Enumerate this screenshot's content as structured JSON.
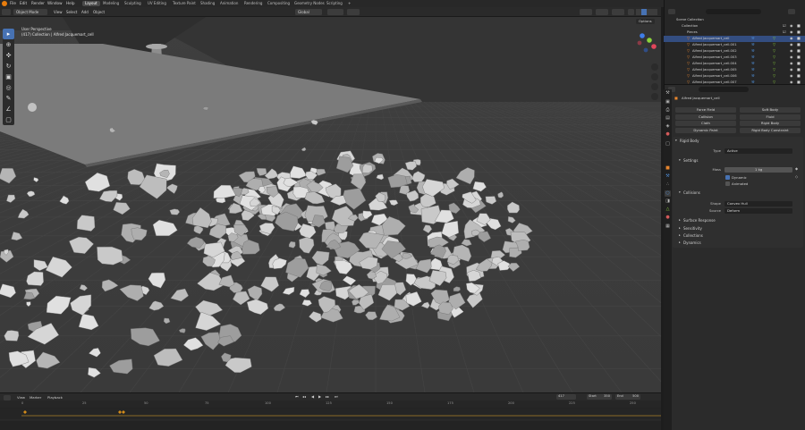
{
  "topbar": {
    "menus": [
      "File",
      "Edit",
      "Render",
      "Window",
      "Help"
    ],
    "workspaces": [
      "Layout",
      "Modeling",
      "Sculpting",
      "UV Editing",
      "Texture Paint",
      "Shading",
      "Animation",
      "Rendering",
      "Compositing",
      "Geometry Nodes",
      "Scripting"
    ],
    "active_workspace": "Layout",
    "scene": "Scene",
    "view_layer": "ViewLayer"
  },
  "viewport_header": {
    "mode": "Object Mode",
    "menus": [
      "View",
      "Select",
      "Add",
      "Object"
    ],
    "transform": "Global",
    "options": "Options"
  },
  "viewport": {
    "perspective": "User Perspective",
    "collection_info": "(417) Collection | Alfred Jacquemart_cell",
    "tools": [
      "cursor-select",
      "cursor",
      "move",
      "rotate",
      "scale",
      "transform",
      "annotate",
      "measure",
      "add-cube"
    ]
  },
  "timeline": {
    "menus": [
      "View",
      "Marker",
      "Playback"
    ],
    "current_frame": "417",
    "start_label": "Start",
    "start": "350",
    "end_label": "End",
    "end": "500",
    "ticks": [
      "0",
      "25",
      "50",
      "75",
      "100",
      "125",
      "150",
      "175",
      "200",
      "225",
      "250"
    ],
    "version": "3.3.1"
  },
  "outliner": {
    "root": "Scene Collection",
    "collection": "Collection",
    "folder": "Pieces",
    "items": [
      "Alfred Jacquemart_cell",
      "Alfred Jacquemart_cell.001",
      "Alfred Jacquemart_cell.002",
      "Alfred Jacquemart_cell.003",
      "Alfred Jacquemart_cell.004",
      "Alfred Jacquemart_cell.005",
      "Alfred Jacquemart_cell.006",
      "Alfred Jacquemart_cell.007"
    ]
  },
  "properties": {
    "object_name": "Alfred Jacquemart_cell",
    "physics_buttons": [
      [
        "Force Field",
        "Soft Body"
      ],
      [
        "Collision",
        "Fluid"
      ],
      [
        "Cloth",
        "Rigid Body"
      ],
      [
        "Dynamic Paint",
        "Rigid Body Constraint"
      ]
    ],
    "rigid_body": {
      "title": "Rigid Body",
      "type_label": "Type",
      "type_value": "Active",
      "settings_title": "Settings",
      "mass_label": "Mass",
      "mass_value": "1 kg",
      "dynamic_label": "Dynamic",
      "animated_label": "Animated",
      "collisions_title": "Collisions",
      "shape_label": "Shape",
      "shape_value": "Convex Hull",
      "source_label": "Source",
      "source_value": "Deform",
      "subsections": [
        "Surface Response",
        "Sensitivity",
        "Collections",
        "Dynamics"
      ]
    }
  },
  "colors": {
    "accent": "#4772b3",
    "selection": "#334d80",
    "playhead": "#d48c1a",
    "axis_x": "#e2465a",
    "axis_y": "#8bd43c",
    "axis_z": "#3f7de8"
  }
}
